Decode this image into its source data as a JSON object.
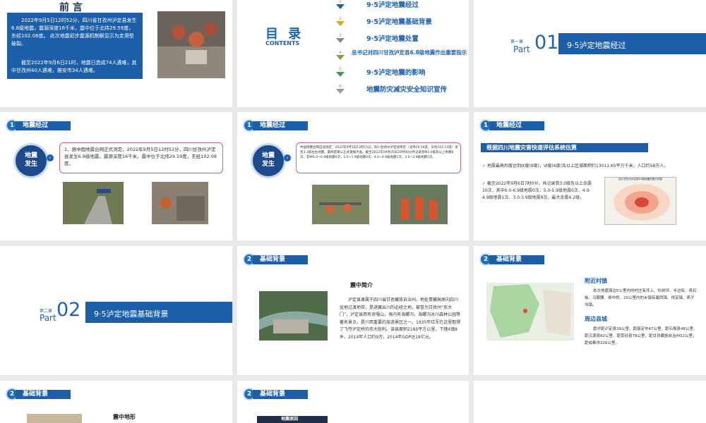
{
  "s1": {
    "title": "前 言",
    "para1": "2022年9月5日12时52分，四川省甘孜州泸定县发生6.8级地震，震源深度16千米，震中位于北纬29.59度，东经102.08度。 此次地震初步震源机制解显示为走滑型破裂。",
    "para2": "截至2022年9月6日21时，地震已造成74人遇难，其中甘孜州40人遇难，雅安市34人遇难。"
  },
  "s2": {
    "title": "目 录",
    "subtitle": "CONTENTS",
    "items": [
      {
        "n": "1",
        "t": "9·5泸定地震经过"
      },
      {
        "n": "2",
        "t": "9·5泸定地震基础背景"
      },
      {
        "n": "3",
        "t": "9·5泸定地震处置"
      },
      {
        "n": "4",
        "t": "总书记对四川甘孜泸定县6.8级地震作出重要指示"
      },
      {
        "n": "5",
        "t": "9·5泸定地震的影响"
      },
      {
        "n": "6",
        "t": "地震防灾减灾安全知识宣传"
      }
    ]
  },
  "s3": {
    "chapter": "第一章",
    "part": "Part",
    "num": "01",
    "title": "9·5泸定地震经过"
  },
  "s4": {
    "badge": "1",
    "header": "地震经过",
    "circle": "地震\n发生",
    "text": "1、据中国地震台网正式测定，2022年9月5日12时52分，四川甘孜州泸定县发生6.8级地震，震源深度16千米，震中位于北纬29.59度，东经102.08度。"
  },
  "s5": {
    "badge": "1",
    "header": "地震经过",
    "circle": "地震\n发生",
    "text": "中国地震台网自动测定：2022年9月5日13时15分，四川甘孜州泸定县附近（北纬29.56度，东经102.13度）发生3.1级左右地震，最终结果以正式速报为准。截至2022年09月05日20时00分共记录到M3.0级及以上余震8次，其中6.0~6.9级地震0次，5.0~5.9级地震0次，4.0~4.9级地震1次，3.0~3.9级地震5次。"
  },
  "s6": {
    "badge": "1",
    "header": "地震经过",
    "banner": "根据四川地震灾害快速评估系统估算",
    "b1": "地震最高烈度达到Ⅸ度(9度)，Ⅵ度(6度)及以上区域面积约13011.65平方千米，人口约58万人。",
    "b2": "截至2022年9月6日7时0分，共记录到3.0级及以上余震10次，其中6.0-6.9级地震0次、5.0-5.9级地震0次、4.0-4.9级地震1次、3.0-3.9级地震9次，最大余震4.2级。",
    "maptitle": "四川甘孜州泸定县6.8级地震烈度分布图"
  },
  "s7": {
    "chapter": "第二章",
    "part": "Part",
    "num": "02",
    "title": "9·5泸定地震基础背景"
  },
  "s8": {
    "badge": "2",
    "header": "基础背景",
    "subtitle": "震中简介",
    "text": "泸定县隶属于四川省甘孜藏族自治州，地处青藏高原向四川盆地过渡地带，是进藏出川的必经之地，被誉为甘孜州“东大门”，泸定县西有贡嘎山，境内有海螺沟，海螺沟冰川森林公园等著名景点，是川西重要的旅游景区之一。1935年红军在这里取得了飞夺泸定桥的伟大胜利。该县面积2165平方公里，下辖4镇8乡，2014年人口约9万，2014年GDP达19亿元。"
  },
  "s9": {
    "badge": "2",
    "header": "基础背景",
    "t1": "附近村镇",
    "p1": "本次地震周边5公里内的村庄有坪上、杉树坪、半边街、青石板、马鞍腰、侯中桥，20公里内的乡镇有磨西镇、得妥镇、燕子沟镇。",
    "t2": "周边县城",
    "p2": "震中距泸定县39公里、距康定市47公里、距石棉县48公里、距汉源县62公里、距荥经县78公里，距甘孜藏族自治州52公里，距成都市226公里。"
  },
  "s10": {
    "badge": "2",
    "header": "基础背景",
    "subtitle": "震中地形"
  },
  "s11": {
    "badge": "2",
    "header": "基础背景",
    "subtitle": "地震原因"
  },
  "colors": {
    "primary": "#1c5fa8",
    "text": "#333333"
  }
}
